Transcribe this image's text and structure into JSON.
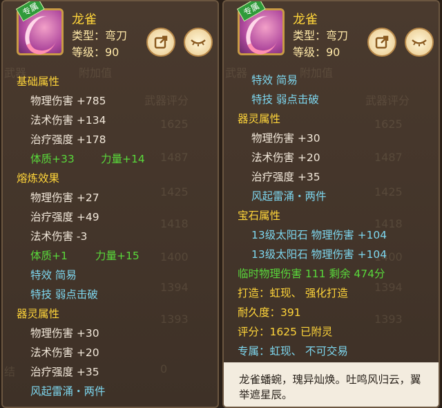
{
  "item": {
    "name": "龙雀",
    "type_label": "类型：弯刀",
    "level_label": "等级：90",
    "exclusive_tag": "专属"
  },
  "background_text": {
    "columns": [
      "武器",
      "附加值",
      "武器评分"
    ],
    "scores": [
      "1625",
      "1487",
      "1425",
      "1418",
      "1400",
      "1394",
      "1393"
    ],
    "partial": [
      "结",
      "0"
    ]
  },
  "left": {
    "base_title": "基础属性",
    "base": [
      "物理伤害 +785",
      "法术伤害 +134",
      "治疗强度 +178"
    ],
    "base_green": [
      "体质+33",
      "力量+14"
    ],
    "smelt_title": "熔炼效果",
    "smelt": [
      "物理伤害 +27",
      "治疗强度 +49",
      "法术伤害 -3"
    ],
    "smelt_green": [
      "体质+1",
      "力量+15"
    ],
    "effects": [
      "特效  简易",
      "特技  弱点击破"
    ],
    "spirit_title": "器灵属性",
    "spirit": [
      "物理伤害 +30",
      "法术伤害 +20",
      "治疗强度 +35"
    ],
    "set": "风起雷涌・两件"
  },
  "right": {
    "effects": [
      "特效  简易",
      "特技  弱点击破"
    ],
    "spirit_title": "器灵属性",
    "spirit": [
      "物理伤害 +30",
      "法术伤害 +20",
      "治疗强度 +35"
    ],
    "set": "风起雷涌・两件",
    "gem_title": "宝石属性",
    "gems": [
      "13级太阳石  物理伤害 +104",
      "13级太阳石  物理伤害 +104"
    ],
    "temp": "临时物理伤害  111  剩余  474分",
    "forge": "打造：虹现、   强化打造",
    "durability": "耐久度：391",
    "score": "评分：1625    已附灵",
    "exclusive": "专属：虹现、   不可交易",
    "description": "龙雀蟠蜿，瑰异灿焕。吐鸣风归云，翼举遮星辰。"
  }
}
